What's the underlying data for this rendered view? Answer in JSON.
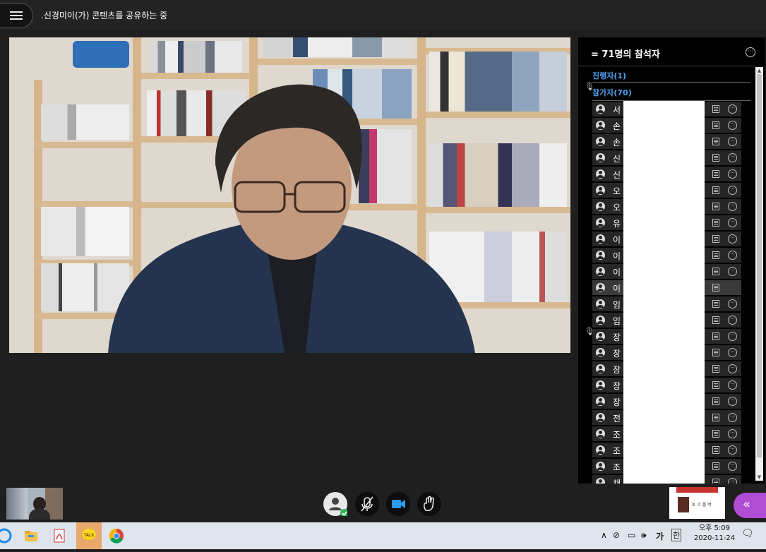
{
  "topbar": {
    "share_text": ".신경미이(가) 콘텐츠를 공유하는 중"
  },
  "panel": {
    "title": "71명의 참석자",
    "host_label": "진행자(1)",
    "participants_label": "참가자(70)",
    "rows": [
      {
        "name": "서"
      },
      {
        "name": "손"
      },
      {
        "name": "손"
      },
      {
        "name": "신"
      },
      {
        "name": "신"
      },
      {
        "name": "오"
      },
      {
        "name": "오"
      },
      {
        "name": "유"
      },
      {
        "name": "이"
      },
      {
        "name": "이"
      },
      {
        "name": "이"
      },
      {
        "name": "이"
      },
      {
        "name": "임"
      },
      {
        "name": "임"
      },
      {
        "name": "장"
      },
      {
        "name": "장"
      },
      {
        "name": "장"
      },
      {
        "name": "장"
      },
      {
        "name": "장"
      },
      {
        "name": "전"
      },
      {
        "name": "조"
      },
      {
        "name": "조"
      },
      {
        "name": "조"
      },
      {
        "name": "채"
      }
    ]
  },
  "share_thumb": {
    "text": "토 크 폴 버"
  },
  "taskbar": {
    "ime_main": "가",
    "ime_lang": "한",
    "time": "오후 5:09",
    "date": "2020-11-24"
  },
  "colors": {
    "accent_blue": "#4ea2f1",
    "purple": "#b14dd5",
    "panel_bg": "#000000"
  }
}
